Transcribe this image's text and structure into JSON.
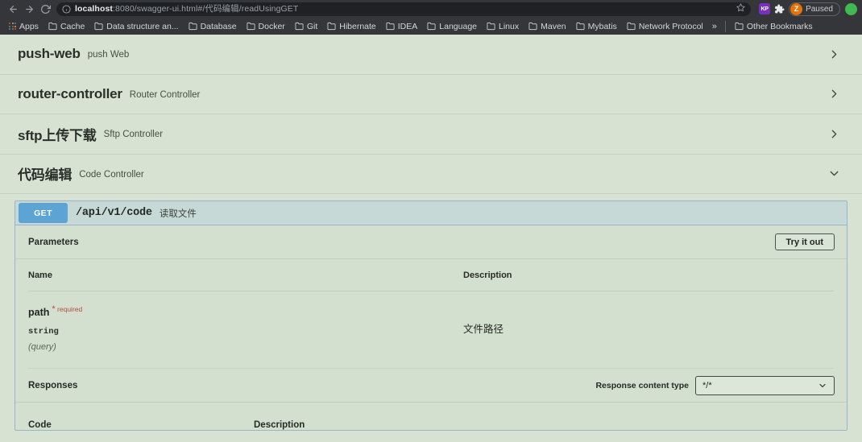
{
  "browser": {
    "nav": {
      "back_icon": "arrow-left-icon",
      "forward_icon": "arrow-right-icon",
      "reload_icon": "reload-icon"
    },
    "omnibox": {
      "info_icon": "info-circle-icon",
      "host": "localhost",
      "path": ":8080/swagger-ui.html#/代码编辑/readUsingGET",
      "star_icon": "star-icon"
    },
    "toolbar_right": {
      "extension_badge_label": "KP",
      "puzzle_icon": "puzzle-piece-icon",
      "profile_initial": "Z",
      "paused_label": "Paused"
    },
    "bookmarks": {
      "apps_label": "Apps",
      "items": [
        "Cache",
        "Data structure an...",
        "Database",
        "Docker",
        "Git",
        "Hibernate",
        "IDEA",
        "Language",
        "Linux",
        "Maven",
        "Mybatis",
        "Network Protocol"
      ],
      "overflow_label": "»",
      "other_bookmarks_label": "Other Bookmarks"
    }
  },
  "swagger": {
    "tags": [
      {
        "name": "push-web",
        "description": "push Web",
        "expanded": false,
        "chevron": "chevron-right-icon"
      },
      {
        "name": "router-controller",
        "description": "Router Controller",
        "expanded": false,
        "chevron": "chevron-right-icon"
      },
      {
        "name": "sftp上传下载",
        "description": "Sftp Controller",
        "expanded": false,
        "chevron": "chevron-right-icon"
      },
      {
        "name": "代码编辑",
        "description": "Code Controller",
        "expanded": true,
        "chevron": "chevron-down-icon"
      }
    ],
    "operation": {
      "method": "GET",
      "path": "/api/v1/code",
      "summary": "读取文件",
      "method_color": "#5ba4d4",
      "parameters_title": "Parameters",
      "try_it_out_label": "Try it out",
      "table_headers": {
        "name": "Name",
        "description": "Description"
      },
      "parameters": [
        {
          "name": "path",
          "required_label": "required",
          "type": "string",
          "in": "(query)",
          "description": "文件路径"
        }
      ],
      "responses_title": "Responses",
      "response_content_type_label": "Response content type",
      "response_content_type_value": "*/*",
      "responses_headers": {
        "code": "Code",
        "description": "Description"
      }
    }
  }
}
